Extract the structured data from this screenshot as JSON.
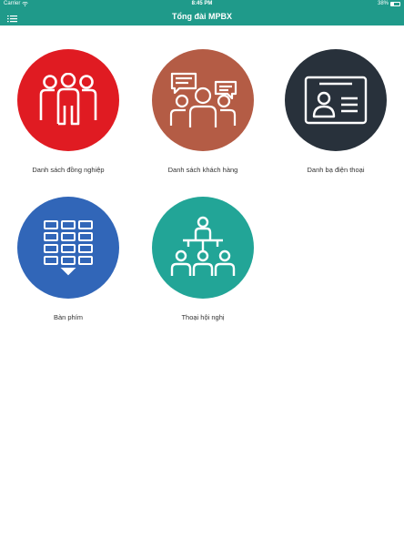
{
  "status_bar": {
    "carrier": "Carrier",
    "time": "8:45 PM",
    "battery": "38%",
    "battery_level": 0.38
  },
  "nav": {
    "title": "Tổng đài MPBX",
    "menu_icon": "list-icon"
  },
  "colors": {
    "accent": "#1f9a8a",
    "red": "#e01b22",
    "brown": "#b45c45",
    "dark": "#28313b",
    "blue": "#3166b8",
    "teal": "#22a597"
  },
  "tiles": [
    {
      "label": "Danh sách đồng nghiệp",
      "icon": "colleagues-icon"
    },
    {
      "label": "Danh sách khách hàng",
      "icon": "customers-icon"
    },
    {
      "label": "Danh bạ điện thoại",
      "icon": "contact-card-icon"
    },
    {
      "label": "Bàn phím",
      "icon": "keypad-icon"
    },
    {
      "label": "Thoại hội nghị",
      "icon": "conference-icon"
    }
  ]
}
